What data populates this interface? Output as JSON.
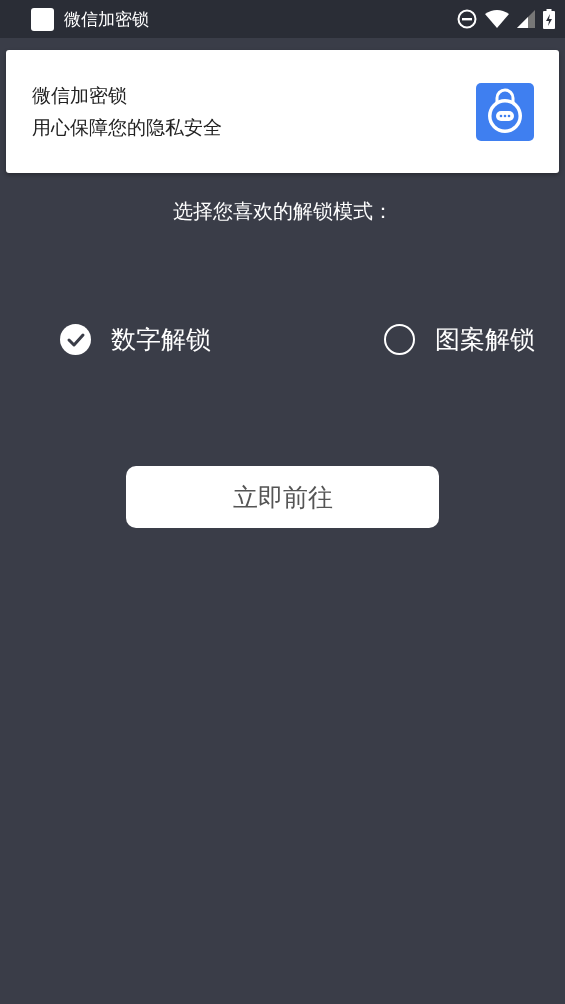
{
  "status_bar": {
    "app_title": "微信加密锁"
  },
  "notification": {
    "title": "微信加密锁",
    "body": "用心保障您的隐私安全"
  },
  "prompt": "选择您喜欢的解锁模式：",
  "modes": [
    {
      "label": "数字解锁",
      "selected": true
    },
    {
      "label": "图案解锁",
      "selected": false
    }
  ],
  "button": "立即前往"
}
